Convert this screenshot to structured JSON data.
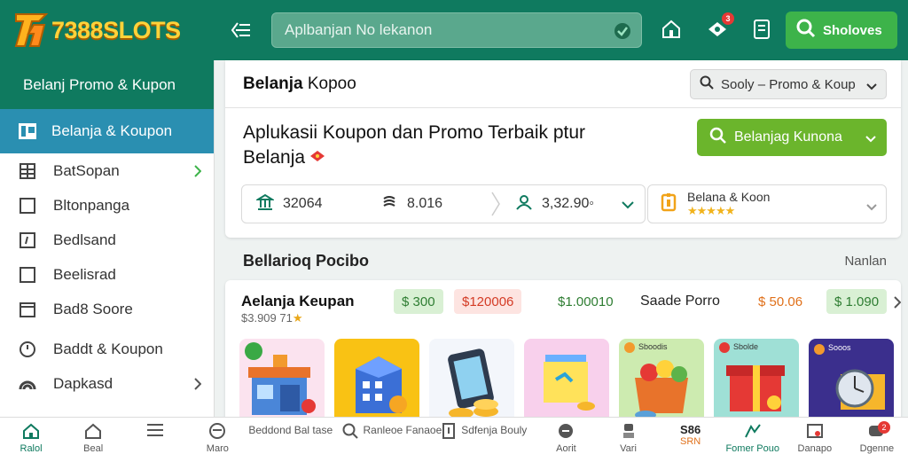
{
  "app": {
    "logo_text": "7388SLOTS",
    "colors": {
      "primary": "#0f7a5f",
      "accent": "#3db34a",
      "sidebar_active": "#2a8fb1",
      "cta": "#6bb52c",
      "logo": "#ffd23a"
    }
  },
  "topbar": {
    "search_placeholder": "Aplbanjan No lekanon",
    "notification_count": "3",
    "search_button_label": "Sholoves",
    "icons": [
      "menu-collapse-icon",
      "verified-icon",
      "home-icon",
      "gift-icon",
      "document-icon",
      "search-icon"
    ]
  },
  "sidebar": {
    "header": "Belanj  Promo & Kupon",
    "active_item": "Belanja & Koupon",
    "items": [
      {
        "label": "BatSopan",
        "icon": "grid-icon",
        "chevron": true
      },
      {
        "label": "Bltonpanga",
        "icon": "square-icon",
        "chevron": false
      },
      {
        "label": "Bedlsand",
        "icon": "tag-icon",
        "chevron": false
      },
      {
        "label": "Beelisrad",
        "icon": "square-icon",
        "chevron": false
      },
      {
        "label": "Bad8 Soore",
        "icon": "store-icon",
        "chevron": false
      },
      {
        "label": "Baddt & Koupon",
        "icon": "clock-icon",
        "chevron": false
      },
      {
        "label": "Dapkasd",
        "icon": "rainbow-icon",
        "chevron": true
      }
    ]
  },
  "main": {
    "section_title_bold": "Belanja",
    "section_title_rest": "Kopoo",
    "sort_label": "Sooly – Promo & Koup",
    "headline_line1": "Aplukasii Koupon dan Promo Terbaik ptur",
    "headline_line2": "Belanja",
    "cta_label": "Belanjag Kunona",
    "stats": [
      {
        "icon": "bank-icon",
        "value": "32064"
      },
      {
        "icon": "coins-icon",
        "value": "8.016"
      },
      {
        "icon": "users-icon",
        "value": "3,32.90◦"
      }
    ],
    "rating": {
      "label": "Belana & Koon",
      "stars": "★★★★★"
    },
    "section2_title": "Bellarioq Pocibo",
    "section2_link": "Nanlan",
    "promo": {
      "title": "Aelanja Keupan",
      "subtitle": "$3.909 71",
      "subtitle_star": "★",
      "brand": "Saade Porro",
      "prices": [
        {
          "text": "$ 300",
          "bg": "#d9f0d4",
          "color": "#2e7d32"
        },
        {
          "text": "$120006",
          "bg": "#fde4e1",
          "color": "#d43b25"
        },
        {
          "text": "$1.00010",
          "bg": "#ffffff",
          "color": "#2e7d32"
        },
        {
          "text": "$ 50.06",
          "bg": "#ffffff",
          "color": "#e0701a"
        },
        {
          "text": "$ 1.090",
          "bg": "#d9f0d4",
          "color": "#2e7d32"
        }
      ],
      "cards": [
        {
          "name": "shop-illustration",
          "bg": "#fbe3ef"
        },
        {
          "name": "building-illustration",
          "bg": "#f9c214"
        },
        {
          "name": "phone-coins-illustration",
          "bg": "#f3f6fb"
        },
        {
          "name": "wallet-illustration",
          "bg": "#f8d0ec"
        },
        {
          "name": "fruit-basket-illustration",
          "bg": "#cdebb0",
          "tag": "Sboodis"
        },
        {
          "name": "gift-box-illustration",
          "bg": "#9fe0d6",
          "tag": "Sbolde"
        },
        {
          "name": "watch-illustration",
          "bg": "#3b2f8d",
          "tag": "Sooos"
        }
      ]
    }
  },
  "bottom_nav": [
    {
      "label": "Ralol",
      "icon": "home-icon",
      "active": true
    },
    {
      "label": "Beal",
      "icon": "home-outline-icon"
    },
    {
      "label": "",
      "icon": "menu-icon"
    },
    {
      "label": "Maro",
      "icon": "cart-icon"
    },
    {
      "label": "Beddond Bal tase",
      "icon": "",
      "wide": true
    },
    {
      "label": "Ranleoe Fanaoe",
      "icon": "search-icon",
      "wide": true
    },
    {
      "label": "Sdfenja Bouly",
      "icon": "document-icon",
      "wide": true
    },
    {
      "label": "Aorit",
      "icon": "send-icon"
    },
    {
      "label": "Vari",
      "icon": "user-icon"
    },
    {
      "label": "SRN",
      "top": "S86",
      "icon": ""
    },
    {
      "label": "Fomer Pouo",
      "icon": "chart-icon",
      "active": true
    },
    {
      "label": "Danapo",
      "icon": "image-icon"
    },
    {
      "label": "Dgenne",
      "icon": "chat-icon",
      "badge": "2"
    }
  ]
}
